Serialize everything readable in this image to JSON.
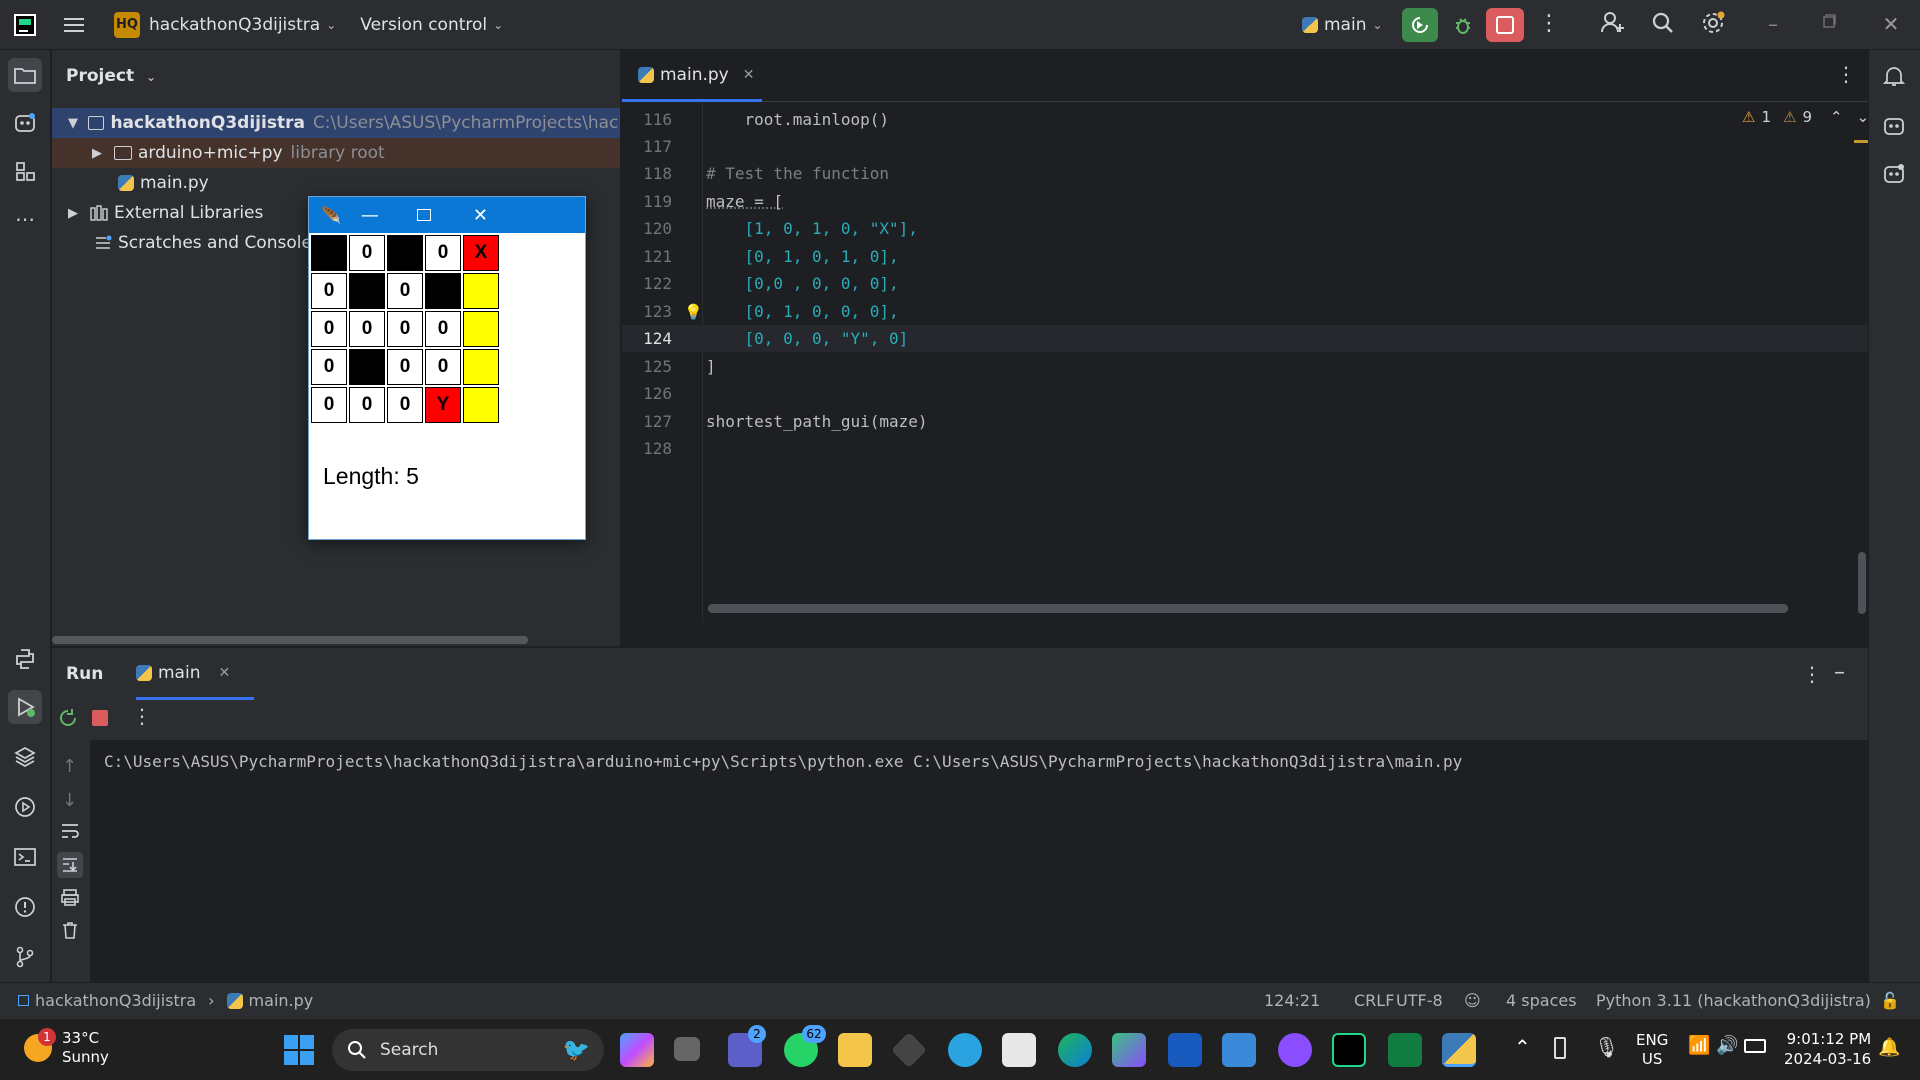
{
  "titlebar": {
    "project_badge": "HQ",
    "project_name": "hackathonQ3dijistra",
    "vcs": "Version control",
    "run_config": "main"
  },
  "project_panel": {
    "title": "Project",
    "root_name": "hackathonQ3dijistra",
    "root_path": "C:\\Users\\ASUS\\PycharmProjects\\hackath",
    "venv_name": "arduino+mic+py",
    "venv_tag": "library root",
    "main_file": "main.py",
    "external_libs": "External Libraries",
    "scratches": "Scratches and Consoles"
  },
  "tk_window": {
    "grid": [
      [
        "",
        "0",
        "",
        "0",
        "X"
      ],
      [
        "0",
        "",
        "0",
        "",
        "  "
      ],
      [
        "0",
        "0",
        "0",
        "0",
        ""
      ],
      [
        "0",
        "",
        "0",
        "0",
        ""
      ],
      [
        "0",
        "0",
        "0",
        "Y",
        ""
      ]
    ],
    "length_label": "Length: 5"
  },
  "editor": {
    "tab_name": "main.py",
    "warnings": "1",
    "weak_warnings": "9",
    "lines": [
      {
        "n": "116",
        "text": "    root.mainloop()"
      },
      {
        "n": "117",
        "text": ""
      },
      {
        "n": "118",
        "text": "# Test the function"
      },
      {
        "n": "119",
        "text": "maze = ["
      },
      {
        "n": "120",
        "text": "    [1, 0, 1, 0, \"X\"],"
      },
      {
        "n": "121",
        "text": "    [0, 1, 0, 1, 0],"
      },
      {
        "n": "122",
        "text": "    [0,0 , 0, 0, 0],"
      },
      {
        "n": "123",
        "text": "    [0, 1, 0, 0, 0],"
      },
      {
        "n": "124",
        "text": "    [0, 0, 0, \"Y\", 0]"
      },
      {
        "n": "125",
        "text": "]"
      },
      {
        "n": "126",
        "text": ""
      },
      {
        "n": "127",
        "text": "shortest_path_gui(maze)"
      },
      {
        "n": "128",
        "text": ""
      }
    ]
  },
  "run_panel": {
    "title": "Run",
    "tab": "main",
    "output": "C:\\Users\\ASUS\\PycharmProjects\\hackathonQ3dijistra\\arduino+mic+py\\Scripts\\python.exe C:\\Users\\ASUS\\PycharmProjects\\hackathonQ3dijistra\\main.py"
  },
  "statusbar": {
    "crumb_project": "hackathonQ3dijistra",
    "crumb_file": "main.py",
    "position": "124:21",
    "line_sep": "CRLF",
    "encoding": "UTF-8",
    "indent": "4 spaces",
    "interpreter": "Python 3.11 (hackathonQ3dijistra)"
  },
  "taskbar": {
    "weather_temp": "33°C",
    "weather_desc": "Sunny",
    "weather_badge": "1",
    "search": "Search",
    "teams_badge": "2",
    "whatsapp_badge": "62",
    "lang": "ENG",
    "region": "US",
    "time": "9:01:12 PM",
    "date": "2024-03-16"
  },
  "colors": {
    "accent": "#3574f0",
    "ide_bg": "#1e1f22",
    "panel_bg": "#2b2d30",
    "tk_red": "#ff0000",
    "tk_yellow": "#ffff00"
  }
}
